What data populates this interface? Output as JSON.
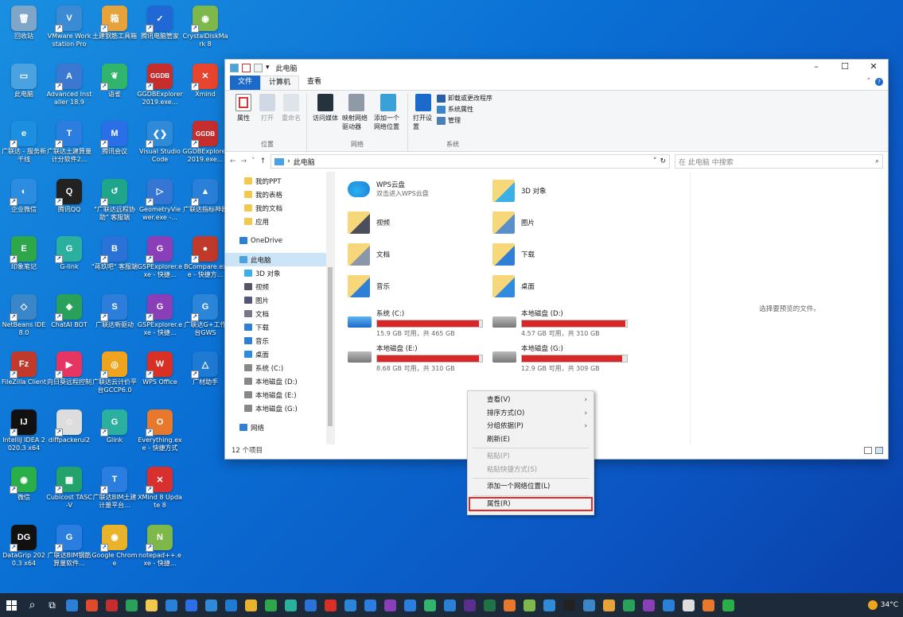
{
  "desktop": {
    "icons": [
      {
        "label": "回收站",
        "color": "#7fa6c9",
        "glyph": "🗑"
      },
      {
        "label": "VMware Workstation Pro",
        "color": "#3b8bd4",
        "glyph": "V"
      },
      {
        "label": "土建钢筋工具箱",
        "color": "#e8a23a",
        "glyph": "箱"
      },
      {
        "label": "腾讯电脑管家",
        "color": "#2167d6",
        "glyph": "✓"
      },
      {
        "label": "CrystalDiskMark 8",
        "color": "#7fb84a",
        "glyph": "◉"
      },
      {
        "label": "此电脑",
        "color": "#4aa3e0",
        "glyph": "▭"
      },
      {
        "label": "Advanced Installer 18.9",
        "color": "#3a78d2",
        "glyph": "A"
      },
      {
        "label": "语雀",
        "color": "#31b46b",
        "glyph": "❦"
      },
      {
        "label": "GGDBExplorer2019.exe...",
        "color": "#c62d2d",
        "glyph": "GGDB"
      },
      {
        "label": "Xmind",
        "color": "#e8452f",
        "glyph": "✕"
      },
      {
        "label": "广联达 - 服务新干线",
        "color": "#1d8fe0",
        "glyph": "e"
      },
      {
        "label": "广联达土建算量计分软件2...",
        "color": "#2b7ee0",
        "glyph": "T"
      },
      {
        "label": "腾讯会议",
        "color": "#2a6fe8",
        "glyph": "M"
      },
      {
        "label": "Visual Studio Code",
        "color": "#2f8ad8",
        "glyph": "❮❯"
      },
      {
        "label": "GGDBExplorer2019.exe...",
        "color": "#c62d2d",
        "glyph": "GGDB"
      },
      {
        "label": "企业微信",
        "color": "#2c8ce0",
        "glyph": "◐"
      },
      {
        "label": "腾讯QQ",
        "color": "#222",
        "glyph": "Q"
      },
      {
        "label": "\"广联达远程协助\" 客服端",
        "color": "#1fa58a",
        "glyph": "↺"
      },
      {
        "label": "GeometryViewer.exe -...",
        "color": "#3575d3",
        "glyph": "▷"
      },
      {
        "label": "广联达指标神器",
        "color": "#2a7fd9",
        "glyph": "▲"
      },
      {
        "label": "印象笔记",
        "color": "#2ea74b",
        "glyph": "E"
      },
      {
        "label": "G-link",
        "color": "#2bb0a0",
        "glyph": "G"
      },
      {
        "label": "\"蒋玖吧\" 客服端",
        "color": "#2a72d8",
        "glyph": "B"
      },
      {
        "label": "GSPExplorer.exe - 快捷...",
        "color": "#8a3fb8",
        "glyph": "G"
      },
      {
        "label": "BCompare.exe - 快捷方...",
        "color": "#c0392b",
        "glyph": "●"
      },
      {
        "label": "NetBeans IDE 8.0",
        "color": "#3a86c9",
        "glyph": "◇"
      },
      {
        "label": "ChatAI BOT",
        "color": "#2aa15a",
        "glyph": "◈"
      },
      {
        "label": "广联达新驱动",
        "color": "#2d7ddb",
        "glyph": "S"
      },
      {
        "label": "GSPExplorer.exe - 快捷...",
        "color": "#8a3fb8",
        "glyph": "G"
      },
      {
        "label": "广联达G+工作台GWS",
        "color": "#2b86d9",
        "glyph": "G"
      },
      {
        "label": "FileZilla Client",
        "color": "#c0392b",
        "glyph": "Fz"
      },
      {
        "label": "向日葵远程控制",
        "color": "#e73563",
        "glyph": "▶"
      },
      {
        "label": "广联达云计价平台GCCP6.0",
        "color": "#f0a31c",
        "glyph": "◎"
      },
      {
        "label": "WPS Office",
        "color": "#d93025",
        "glyph": "W"
      },
      {
        "label": "广材助手",
        "color": "#1f7ad4",
        "glyph": "△"
      },
      {
        "label": "IntelliJ IDEA 2020.3 x64",
        "color": "#111",
        "glyph": "IJ"
      },
      {
        "label": "diffpackerui2",
        "color": "#ddd",
        "glyph": "☺"
      },
      {
        "label": "Glink",
        "color": "#2bb0a0",
        "glyph": "G"
      },
      {
        "label": "Everything.exe - 快捷方式",
        "color": "#e8792c",
        "glyph": "O"
      },
      {
        "label": "",
        "color": "transparent",
        "glyph": ""
      },
      {
        "label": "微信",
        "color": "#2aae47",
        "glyph": "◉"
      },
      {
        "label": "Cubicost TASC-V",
        "color": "#23a36b",
        "glyph": "▦"
      },
      {
        "label": "广联达BIM土建计量平台...",
        "color": "#2a7ee0",
        "glyph": "T"
      },
      {
        "label": "XMind 8 Update 8",
        "color": "#d82f2f",
        "glyph": "✕"
      },
      {
        "label": "",
        "color": "transparent",
        "glyph": ""
      },
      {
        "label": "DataGrip 2020.3 x64",
        "color": "#111",
        "glyph": "DG"
      },
      {
        "label": "广联达BIM钢筋算量软件...",
        "color": "#2a7ee0",
        "glyph": "G"
      },
      {
        "label": "Google Chrome",
        "color": "#e8b32a",
        "glyph": "◉"
      },
      {
        "label": "notepad++.exe - 快捷...",
        "color": "#7fb84a",
        "glyph": "N"
      }
    ]
  },
  "window": {
    "title": "此电脑",
    "controls": {
      "minimize": "–",
      "maximize": "☐",
      "close": "✕"
    },
    "tabs": {
      "file": "文件",
      "computer": "计算机",
      "view": "查看"
    },
    "ribbon": {
      "location": {
        "name": "位置",
        "items": [
          {
            "label": "属性",
            "disabled": false
          },
          {
            "label": "打开",
            "disabled": true
          },
          {
            "label": "重命名",
            "disabled": true
          }
        ]
      },
      "network": {
        "name": "网络",
        "items": [
          {
            "label": "访问媒体"
          },
          {
            "label": "映射网络驱动器"
          },
          {
            "label": "添加一个网络位置"
          }
        ]
      },
      "system": {
        "name": "系统",
        "open_settings": "打开设置",
        "small": [
          "卸载或更改程序",
          "系统属性",
          "管理"
        ]
      }
    },
    "address": {
      "path": "此电脑",
      "search_placeholder": "在 此电脑 中搜索"
    },
    "nav": [
      {
        "label": "我的PPT",
        "color": "#f2c94c",
        "indent": 24,
        "sel": false
      },
      {
        "label": "我的表格",
        "color": "#f2c94c",
        "indent": 24,
        "sel": false
      },
      {
        "label": "我的文档",
        "color": "#f2c94c",
        "indent": 24,
        "sel": false
      },
      {
        "label": "应用",
        "color": "#f2c94c",
        "indent": 24,
        "sel": false
      },
      {
        "label": "OneDrive",
        "color": "#2f7fd6",
        "indent": 18,
        "sel": false
      },
      {
        "label": "此电脑",
        "color": "#4aa3e0",
        "indent": 18,
        "sel": true
      },
      {
        "label": "3D 对象",
        "color": "#3bb0e8",
        "indent": 24,
        "sel": false
      },
      {
        "label": "视频",
        "color": "#556",
        "indent": 24,
        "sel": false
      },
      {
        "label": "图片",
        "color": "#557",
        "indent": 24,
        "sel": false
      },
      {
        "label": "文档",
        "color": "#778",
        "indent": 24,
        "sel": false
      },
      {
        "label": "下载",
        "color": "#2f7fd6",
        "indent": 24,
        "sel": false
      },
      {
        "label": "音乐",
        "color": "#2f7fd6",
        "indent": 24,
        "sel": false
      },
      {
        "label": "桌面",
        "color": "#2f8ae0",
        "indent": 24,
        "sel": false
      },
      {
        "label": "系统 (C:)",
        "color": "#888",
        "indent": 24,
        "sel": false
      },
      {
        "label": "本地磁盘 (D:)",
        "color": "#888",
        "indent": 24,
        "sel": false
      },
      {
        "label": "本地磁盘 (E:)",
        "color": "#888",
        "indent": 24,
        "sel": false
      },
      {
        "label": "本地磁盘 (G:)",
        "color": "#888",
        "indent": 24,
        "sel": false
      },
      {
        "label": "网络",
        "color": "#2f7fd6",
        "indent": 18,
        "sel": false
      }
    ],
    "content": {
      "wps": {
        "name": "WPS云盘",
        "sub": "双击进入WPS云盘"
      },
      "folders": [
        {
          "label": "3D 对象"
        },
        {
          "label": "视频"
        },
        {
          "label": "图片"
        },
        {
          "label": "文档"
        },
        {
          "label": "下载"
        },
        {
          "label": "音乐"
        },
        {
          "label": "桌面"
        }
      ],
      "drives": [
        {
          "name": "系统 (C:)",
          "size": "15.9 GB 可用，共 465 GB",
          "used": 0.966
        },
        {
          "name": "本地磁盘 (D:)",
          "size": "4.57 GB 可用，共 310 GB",
          "used": 0.985
        },
        {
          "name": "本地磁盘 (E:)",
          "size": "8.68 GB 可用，共 310 GB",
          "used": 0.972
        },
        {
          "name": "本地磁盘 (G:)",
          "size": "12.9 GB 可用，共 309 GB",
          "used": 0.958
        }
      ]
    },
    "preview_text": "选择要预览的文件。",
    "status": "12 个项目"
  },
  "context_menu": {
    "items": [
      {
        "label": "查看(V)",
        "submenu": true,
        "disabled": false
      },
      {
        "label": "排序方式(O)",
        "submenu": true,
        "disabled": false
      },
      {
        "label": "分组依据(P)",
        "submenu": true,
        "disabled": false
      },
      {
        "label": "刷新(E)",
        "submenu": false,
        "disabled": false
      },
      {
        "label": "粘贴(P)",
        "submenu": false,
        "disabled": true
      },
      {
        "label": "粘贴快捷方式(S)",
        "submenu": false,
        "disabled": true
      },
      {
        "label": "添加一个网络位置(L)",
        "submenu": false,
        "disabled": false
      },
      {
        "label": "属性(R)",
        "submenu": false,
        "disabled": false,
        "highlighted": true
      }
    ]
  },
  "taskbar": {
    "apps": [
      "#2a7fd9",
      "#e04a2a",
      "#c62d2d",
      "#2aa15a",
      "#f2c94c",
      "#2a7fd9",
      "#2a6fe8",
      "#2f8ad8",
      "#1f7ad4",
      "#e8b32a",
      "#2ea74b",
      "#2bb0a0",
      "#2a72d8",
      "#d93025",
      "#2a86d9",
      "#2b7ee0",
      "#8a3fb8",
      "#2a7ee0",
      "#31b46b",
      "#2a7fd9",
      "#5c2d91",
      "#217346",
      "#e8792c",
      "#7fb84a",
      "#2f8ad8",
      "#222",
      "#3a86c9",
      "#e8a23a",
      "#2aa15a",
      "#8a3fb8",
      "#2a7fd9",
      "#ddd",
      "#e8792c",
      "#2aae47"
    ],
    "temperature": "34°C"
  }
}
